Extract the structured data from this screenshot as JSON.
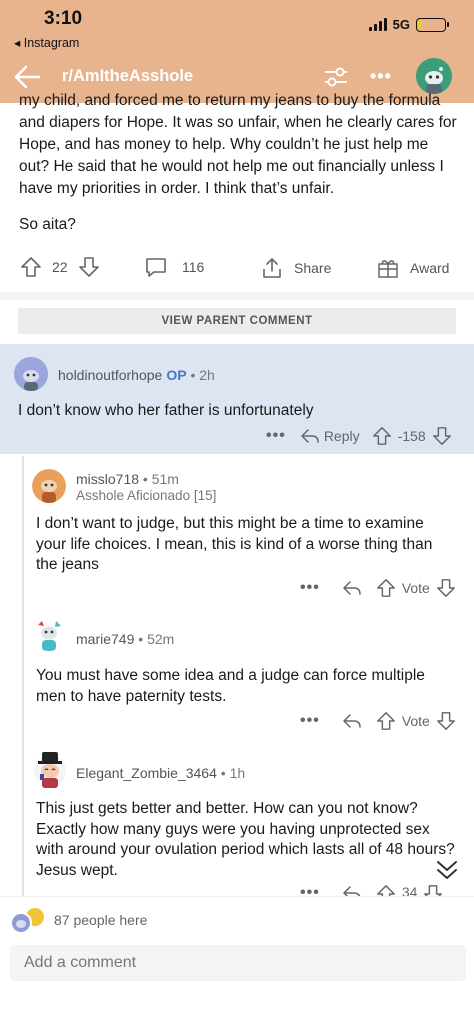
{
  "status_bar": {
    "time": "3:10",
    "back_app": "◂ Instagram",
    "network": "5G",
    "battery_percent": 15
  },
  "header": {
    "subreddit": "r/AmItheAsshole",
    "back_icon": "arrow-left-icon",
    "filter_icon": "sliders-icon",
    "more_icon": "more-dots-icon"
  },
  "post": {
    "paragraphs": [
      "my child, and forced me to return my jeans to buy the formula and diapers for Hope. It was so unfair, when he clearly cares for Hope, and has money to help. Why couldn’t he just help me out? He said that he would not help me out financially unless I have my priorities in order. I think that’s unfair.",
      "So aita?"
    ],
    "upvotes": "22",
    "comments": "116",
    "share_label": "Share",
    "award_label": "Award"
  },
  "view_parent_label": "VIEW PARENT COMMENT",
  "comments": [
    {
      "author": "holdinoutforhope",
      "op_badge": "OP",
      "time": "2h",
      "text": "I don’t know who her father is unfortunately",
      "reply_label": "Reply",
      "score": "-158"
    },
    {
      "author": "misslo718",
      "time": "51m",
      "flair": "Asshole Aficionado [15]",
      "text": "I don’t want to judge, but this might be a time to examine your life choices. I mean, this is kind of a worse thing than the jeans",
      "score": "Vote"
    },
    {
      "author": "marie749",
      "time": "52m",
      "text": "You must have some idea and a judge can force multiple men to have paternity tests.",
      "score": "Vote"
    },
    {
      "author": "Elegant_Zombie_3464",
      "time": "1h",
      "text": "This just gets better and better. How can you not know? Exactly how many guys were you having unprotected sex with around your ovulation period which lasts all of 48 hours? Jesus wept.",
      "score": "34"
    }
  ],
  "bottom": {
    "people_here": "87 people here",
    "add_comment_placeholder": "Add a comment"
  },
  "colors": {
    "header_bg": "#e8b48e",
    "op_highlight": "#dde4f2",
    "op_badge": "#4a76c8"
  }
}
